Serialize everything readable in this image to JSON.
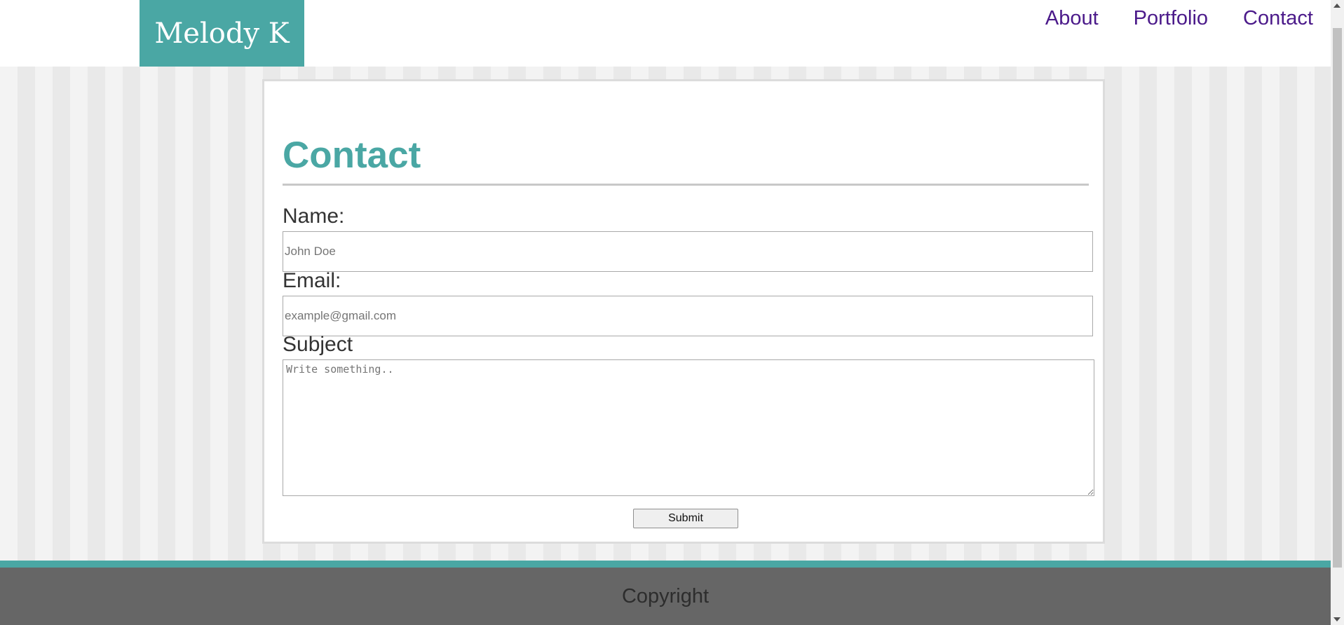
{
  "header": {
    "logo": "Melody K",
    "nav": [
      {
        "label": "About"
      },
      {
        "label": "Portfolio"
      },
      {
        "label": "Contact"
      }
    ]
  },
  "contact": {
    "title": "Contact",
    "name_label": "Name:",
    "name_placeholder": "John Doe",
    "email_label": "Email:",
    "email_placeholder": "example@gmail.com",
    "subject_label": "Subject",
    "subject_placeholder": "Write something..",
    "submit_label": "Submit"
  },
  "footer": {
    "copyright": "Copyright"
  },
  "colors": {
    "brand_teal": "#4aa7a4",
    "nav_link": "#4b1a8a",
    "footer_bg": "#666666"
  }
}
